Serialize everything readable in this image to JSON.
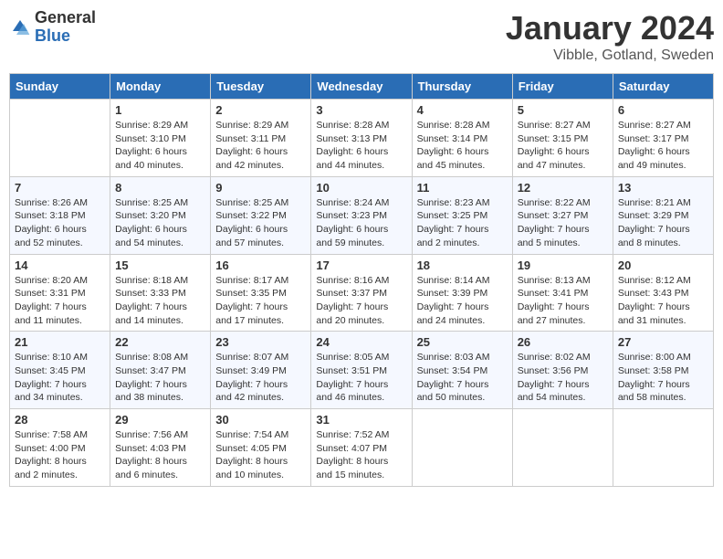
{
  "header": {
    "logo_general": "General",
    "logo_blue": "Blue",
    "month_title": "January 2024",
    "subtitle": "Vibble, Gotland, Sweden"
  },
  "days_of_week": [
    "Sunday",
    "Monday",
    "Tuesday",
    "Wednesday",
    "Thursday",
    "Friday",
    "Saturday"
  ],
  "weeks": [
    [
      {
        "day": "",
        "sunrise": "",
        "sunset": "",
        "daylight": ""
      },
      {
        "day": "1",
        "sunrise": "Sunrise: 8:29 AM",
        "sunset": "Sunset: 3:10 PM",
        "daylight": "Daylight: 6 hours and 40 minutes."
      },
      {
        "day": "2",
        "sunrise": "Sunrise: 8:29 AM",
        "sunset": "Sunset: 3:11 PM",
        "daylight": "Daylight: 6 hours and 42 minutes."
      },
      {
        "day": "3",
        "sunrise": "Sunrise: 8:28 AM",
        "sunset": "Sunset: 3:13 PM",
        "daylight": "Daylight: 6 hours and 44 minutes."
      },
      {
        "day": "4",
        "sunrise": "Sunrise: 8:28 AM",
        "sunset": "Sunset: 3:14 PM",
        "daylight": "Daylight: 6 hours and 45 minutes."
      },
      {
        "day": "5",
        "sunrise": "Sunrise: 8:27 AM",
        "sunset": "Sunset: 3:15 PM",
        "daylight": "Daylight: 6 hours and 47 minutes."
      },
      {
        "day": "6",
        "sunrise": "Sunrise: 8:27 AM",
        "sunset": "Sunset: 3:17 PM",
        "daylight": "Daylight: 6 hours and 49 minutes."
      }
    ],
    [
      {
        "day": "7",
        "sunrise": "Sunrise: 8:26 AM",
        "sunset": "Sunset: 3:18 PM",
        "daylight": "Daylight: 6 hours and 52 minutes."
      },
      {
        "day": "8",
        "sunrise": "Sunrise: 8:25 AM",
        "sunset": "Sunset: 3:20 PM",
        "daylight": "Daylight: 6 hours and 54 minutes."
      },
      {
        "day": "9",
        "sunrise": "Sunrise: 8:25 AM",
        "sunset": "Sunset: 3:22 PM",
        "daylight": "Daylight: 6 hours and 57 minutes."
      },
      {
        "day": "10",
        "sunrise": "Sunrise: 8:24 AM",
        "sunset": "Sunset: 3:23 PM",
        "daylight": "Daylight: 6 hours and 59 minutes."
      },
      {
        "day": "11",
        "sunrise": "Sunrise: 8:23 AM",
        "sunset": "Sunset: 3:25 PM",
        "daylight": "Daylight: 7 hours and 2 minutes."
      },
      {
        "day": "12",
        "sunrise": "Sunrise: 8:22 AM",
        "sunset": "Sunset: 3:27 PM",
        "daylight": "Daylight: 7 hours and 5 minutes."
      },
      {
        "day": "13",
        "sunrise": "Sunrise: 8:21 AM",
        "sunset": "Sunset: 3:29 PM",
        "daylight": "Daylight: 7 hours and 8 minutes."
      }
    ],
    [
      {
        "day": "14",
        "sunrise": "Sunrise: 8:20 AM",
        "sunset": "Sunset: 3:31 PM",
        "daylight": "Daylight: 7 hours and 11 minutes."
      },
      {
        "day": "15",
        "sunrise": "Sunrise: 8:18 AM",
        "sunset": "Sunset: 3:33 PM",
        "daylight": "Daylight: 7 hours and 14 minutes."
      },
      {
        "day": "16",
        "sunrise": "Sunrise: 8:17 AM",
        "sunset": "Sunset: 3:35 PM",
        "daylight": "Daylight: 7 hours and 17 minutes."
      },
      {
        "day": "17",
        "sunrise": "Sunrise: 8:16 AM",
        "sunset": "Sunset: 3:37 PM",
        "daylight": "Daylight: 7 hours and 20 minutes."
      },
      {
        "day": "18",
        "sunrise": "Sunrise: 8:14 AM",
        "sunset": "Sunset: 3:39 PM",
        "daylight": "Daylight: 7 hours and 24 minutes."
      },
      {
        "day": "19",
        "sunrise": "Sunrise: 8:13 AM",
        "sunset": "Sunset: 3:41 PM",
        "daylight": "Daylight: 7 hours and 27 minutes."
      },
      {
        "day": "20",
        "sunrise": "Sunrise: 8:12 AM",
        "sunset": "Sunset: 3:43 PM",
        "daylight": "Daylight: 7 hours and 31 minutes."
      }
    ],
    [
      {
        "day": "21",
        "sunrise": "Sunrise: 8:10 AM",
        "sunset": "Sunset: 3:45 PM",
        "daylight": "Daylight: 7 hours and 34 minutes."
      },
      {
        "day": "22",
        "sunrise": "Sunrise: 8:08 AM",
        "sunset": "Sunset: 3:47 PM",
        "daylight": "Daylight: 7 hours and 38 minutes."
      },
      {
        "day": "23",
        "sunrise": "Sunrise: 8:07 AM",
        "sunset": "Sunset: 3:49 PM",
        "daylight": "Daylight: 7 hours and 42 minutes."
      },
      {
        "day": "24",
        "sunrise": "Sunrise: 8:05 AM",
        "sunset": "Sunset: 3:51 PM",
        "daylight": "Daylight: 7 hours and 46 minutes."
      },
      {
        "day": "25",
        "sunrise": "Sunrise: 8:03 AM",
        "sunset": "Sunset: 3:54 PM",
        "daylight": "Daylight: 7 hours and 50 minutes."
      },
      {
        "day": "26",
        "sunrise": "Sunrise: 8:02 AM",
        "sunset": "Sunset: 3:56 PM",
        "daylight": "Daylight: 7 hours and 54 minutes."
      },
      {
        "day": "27",
        "sunrise": "Sunrise: 8:00 AM",
        "sunset": "Sunset: 3:58 PM",
        "daylight": "Daylight: 7 hours and 58 minutes."
      }
    ],
    [
      {
        "day": "28",
        "sunrise": "Sunrise: 7:58 AM",
        "sunset": "Sunset: 4:00 PM",
        "daylight": "Daylight: 8 hours and 2 minutes."
      },
      {
        "day": "29",
        "sunrise": "Sunrise: 7:56 AM",
        "sunset": "Sunset: 4:03 PM",
        "daylight": "Daylight: 8 hours and 6 minutes."
      },
      {
        "day": "30",
        "sunrise": "Sunrise: 7:54 AM",
        "sunset": "Sunset: 4:05 PM",
        "daylight": "Daylight: 8 hours and 10 minutes."
      },
      {
        "day": "31",
        "sunrise": "Sunrise: 7:52 AM",
        "sunset": "Sunset: 4:07 PM",
        "daylight": "Daylight: 8 hours and 15 minutes."
      },
      {
        "day": "",
        "sunrise": "",
        "sunset": "",
        "daylight": ""
      },
      {
        "day": "",
        "sunrise": "",
        "sunset": "",
        "daylight": ""
      },
      {
        "day": "",
        "sunrise": "",
        "sunset": "",
        "daylight": ""
      }
    ]
  ]
}
